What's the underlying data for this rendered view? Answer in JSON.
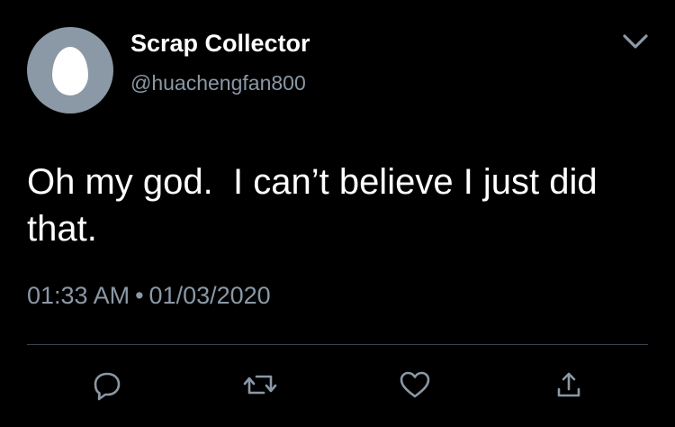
{
  "author": {
    "display_name": "Scrap Collector",
    "handle": "@huachengfan800",
    "avatar_icon": "default-egg-avatar"
  },
  "menu": {
    "icon": "chevron-down-icon"
  },
  "tweet": {
    "text": "Oh my god.  I can’t believe I just did that.",
    "time": "01:33 AM",
    "separator": "•",
    "date": "01/03/2020"
  },
  "actions": [
    {
      "name": "reply",
      "icon": "reply-icon"
    },
    {
      "name": "retweet",
      "icon": "retweet-icon"
    },
    {
      "name": "like",
      "icon": "heart-icon"
    },
    {
      "name": "share",
      "icon": "share-icon"
    }
  ],
  "colors": {
    "background": "#000000",
    "primary_text": "#ffffff",
    "secondary_text": "#8b98a5",
    "divider": "#38444d",
    "avatar_bg": "#8b98a5"
  }
}
